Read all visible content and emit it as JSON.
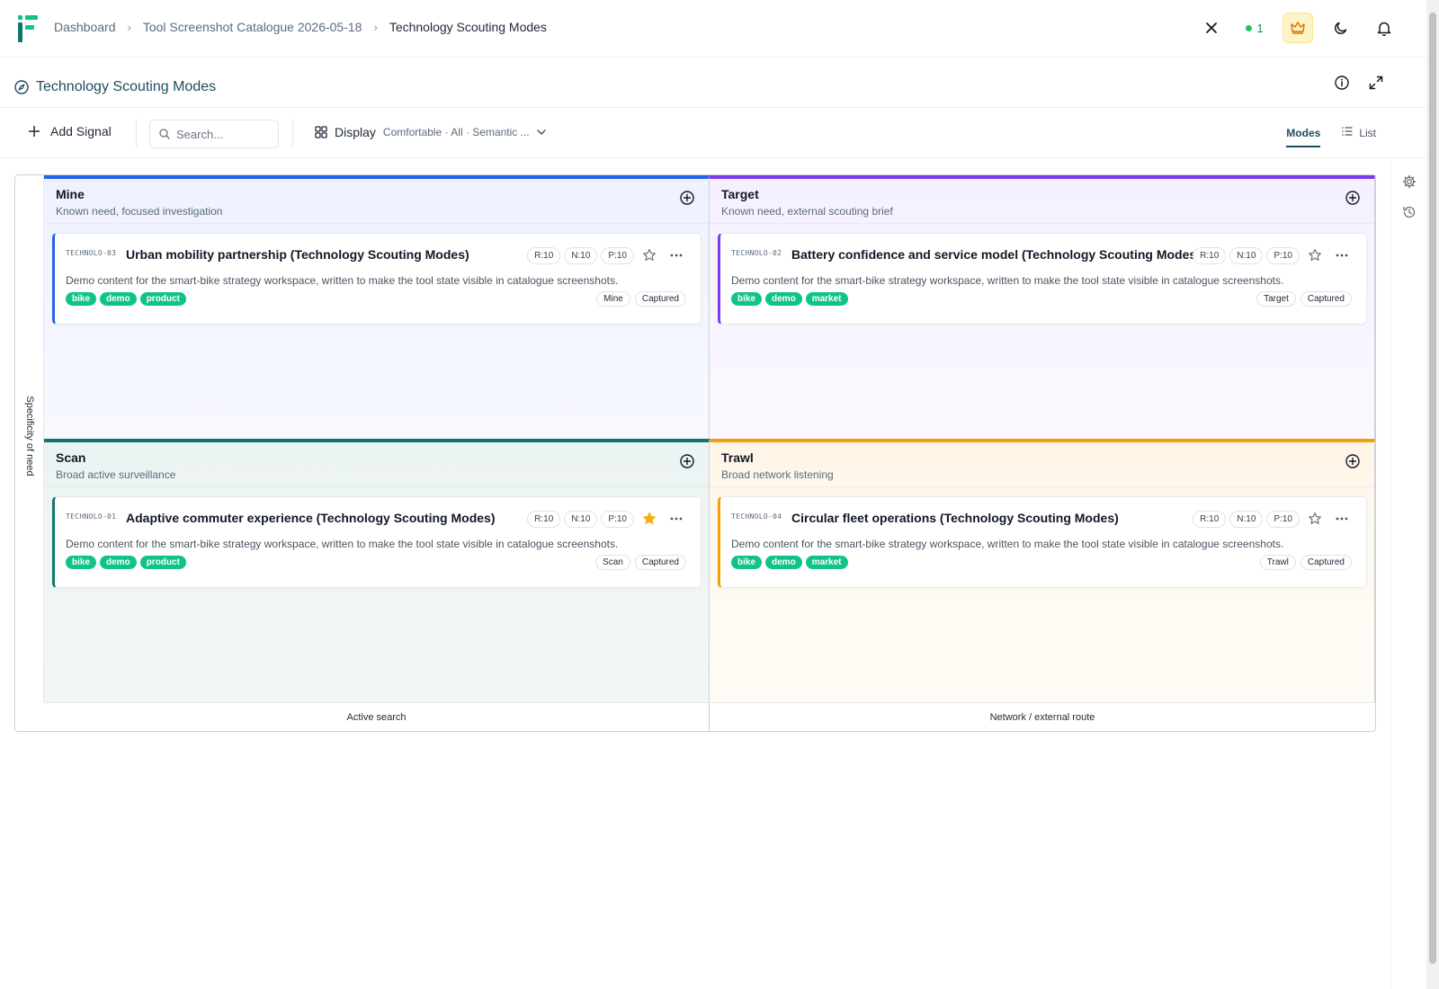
{
  "breadcrumbs": [
    "Dashboard",
    "Tool Screenshot Catalogue 2026-05-18",
    "Technology Scouting Modes"
  ],
  "presence_count": "1",
  "page_title": "Technology Scouting Modes",
  "toolbar": {
    "add_signal_label": "Add Signal",
    "search_placeholder": "Search...",
    "display_label": "Display",
    "display_summary": "Comfortable · All · Semantic ...",
    "tabs": [
      {
        "label": "Modes",
        "active": true
      },
      {
        "label": "List",
        "active": false
      }
    ]
  },
  "axes": {
    "y_label": "Specificity of need",
    "x_labels": [
      "Active search",
      "Network / external route"
    ]
  },
  "colors": {
    "mine": "#2563eb",
    "target": "#7c3aed",
    "scan": "#0f766e",
    "trawl": "#f59e0b",
    "tag": "#10c38a",
    "star_active": "#f5b014"
  },
  "quadrants": [
    {
      "key": "mine",
      "title": "Mine",
      "subtitle": "Known need, focused investigation",
      "card": {
        "id": "TECHNOLO-03",
        "title": "Urban mobility partnership (Technology Scouting Modes)",
        "description": "Demo content for the smart-bike strategy workspace, written to make the tool state visible in catalogue screenshots.",
        "tags": [
          "bike",
          "demo",
          "product"
        ],
        "metrics": [
          "R:10",
          "N:10",
          "P:10"
        ],
        "starred": false,
        "mode": "Mine",
        "status": "Captured"
      }
    },
    {
      "key": "target",
      "title": "Target",
      "subtitle": "Known need, external scouting brief",
      "card": {
        "id": "TECHNOLO-02",
        "title": "Battery confidence and service model (Technology Scouting Modes)",
        "description": "Demo content for the smart-bike strategy workspace, written to make the tool state visible in catalogue screenshots.",
        "tags": [
          "bike",
          "demo",
          "market"
        ],
        "metrics": [
          "R:10",
          "N:10",
          "P:10"
        ],
        "starred": false,
        "mode": "Target",
        "status": "Captured"
      }
    },
    {
      "key": "scan",
      "title": "Scan",
      "subtitle": "Broad active surveillance",
      "card": {
        "id": "TECHNOLO-01",
        "title": "Adaptive commuter experience (Technology Scouting Modes)",
        "description": "Demo content for the smart-bike strategy workspace, written to make the tool state visible in catalogue screenshots.",
        "tags": [
          "bike",
          "demo",
          "product"
        ],
        "metrics": [
          "R:10",
          "N:10",
          "P:10"
        ],
        "starred": true,
        "mode": "Scan",
        "status": "Captured"
      }
    },
    {
      "key": "trawl",
      "title": "Trawl",
      "subtitle": "Broad network listening",
      "card": {
        "id": "TECHNOLO-04",
        "title": "Circular fleet operations (Technology Scouting Modes)",
        "description": "Demo content for the smart-bike strategy workspace, written to make the tool state visible in catalogue screenshots.",
        "tags": [
          "bike",
          "demo",
          "market"
        ],
        "metrics": [
          "R:10",
          "N:10",
          "P:10"
        ],
        "starred": false,
        "mode": "Trawl",
        "status": "Captured"
      }
    }
  ]
}
